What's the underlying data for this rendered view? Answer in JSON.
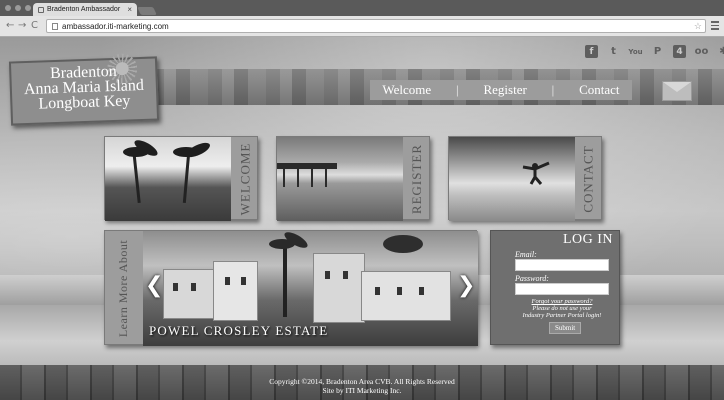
{
  "browser": {
    "tab_title": "Bradenton Ambassador",
    "tab_close": "×",
    "url": "ambassador.iti-marketing.com",
    "back": "←",
    "forward": "→",
    "reload": "C",
    "star": "☆"
  },
  "social": [
    "f",
    "t",
    "You",
    "P",
    "4",
    "oo",
    "✱"
  ],
  "social_icons": [
    "facebook-icon",
    "twitter-icon",
    "youtube-icon",
    "pinterest-icon",
    "foursquare-icon",
    "tripadvisor-icon",
    "yelp-icon"
  ],
  "logo": {
    "line1": "Bradenton",
    "line2": "Anna Maria Island",
    "line3": "Longboat Key"
  },
  "nav": {
    "welcome": "Welcome",
    "sep": "|",
    "register": "Register",
    "contact": "Contact"
  },
  "tiles": {
    "welcome": "WELCOME",
    "register": "REGISTER",
    "contact": "CONTACT"
  },
  "feature": {
    "side_label": "Learn More About",
    "caption": "POWEL CROSLEY ESTATE",
    "prev": "❮",
    "next": "❯"
  },
  "login": {
    "title": "LOG IN",
    "email_label": "Email:",
    "password_label": "Password:",
    "forgot": "Forgot your password?",
    "note1": "Please do not use your",
    "note2": "Industry Partner Portal login!",
    "submit": "Submit"
  },
  "footer": {
    "line1": "Copyright ©2014, Bradenton Area CVB. All Rights Reserved",
    "line2": "Site by ITI Marketing Inc."
  }
}
